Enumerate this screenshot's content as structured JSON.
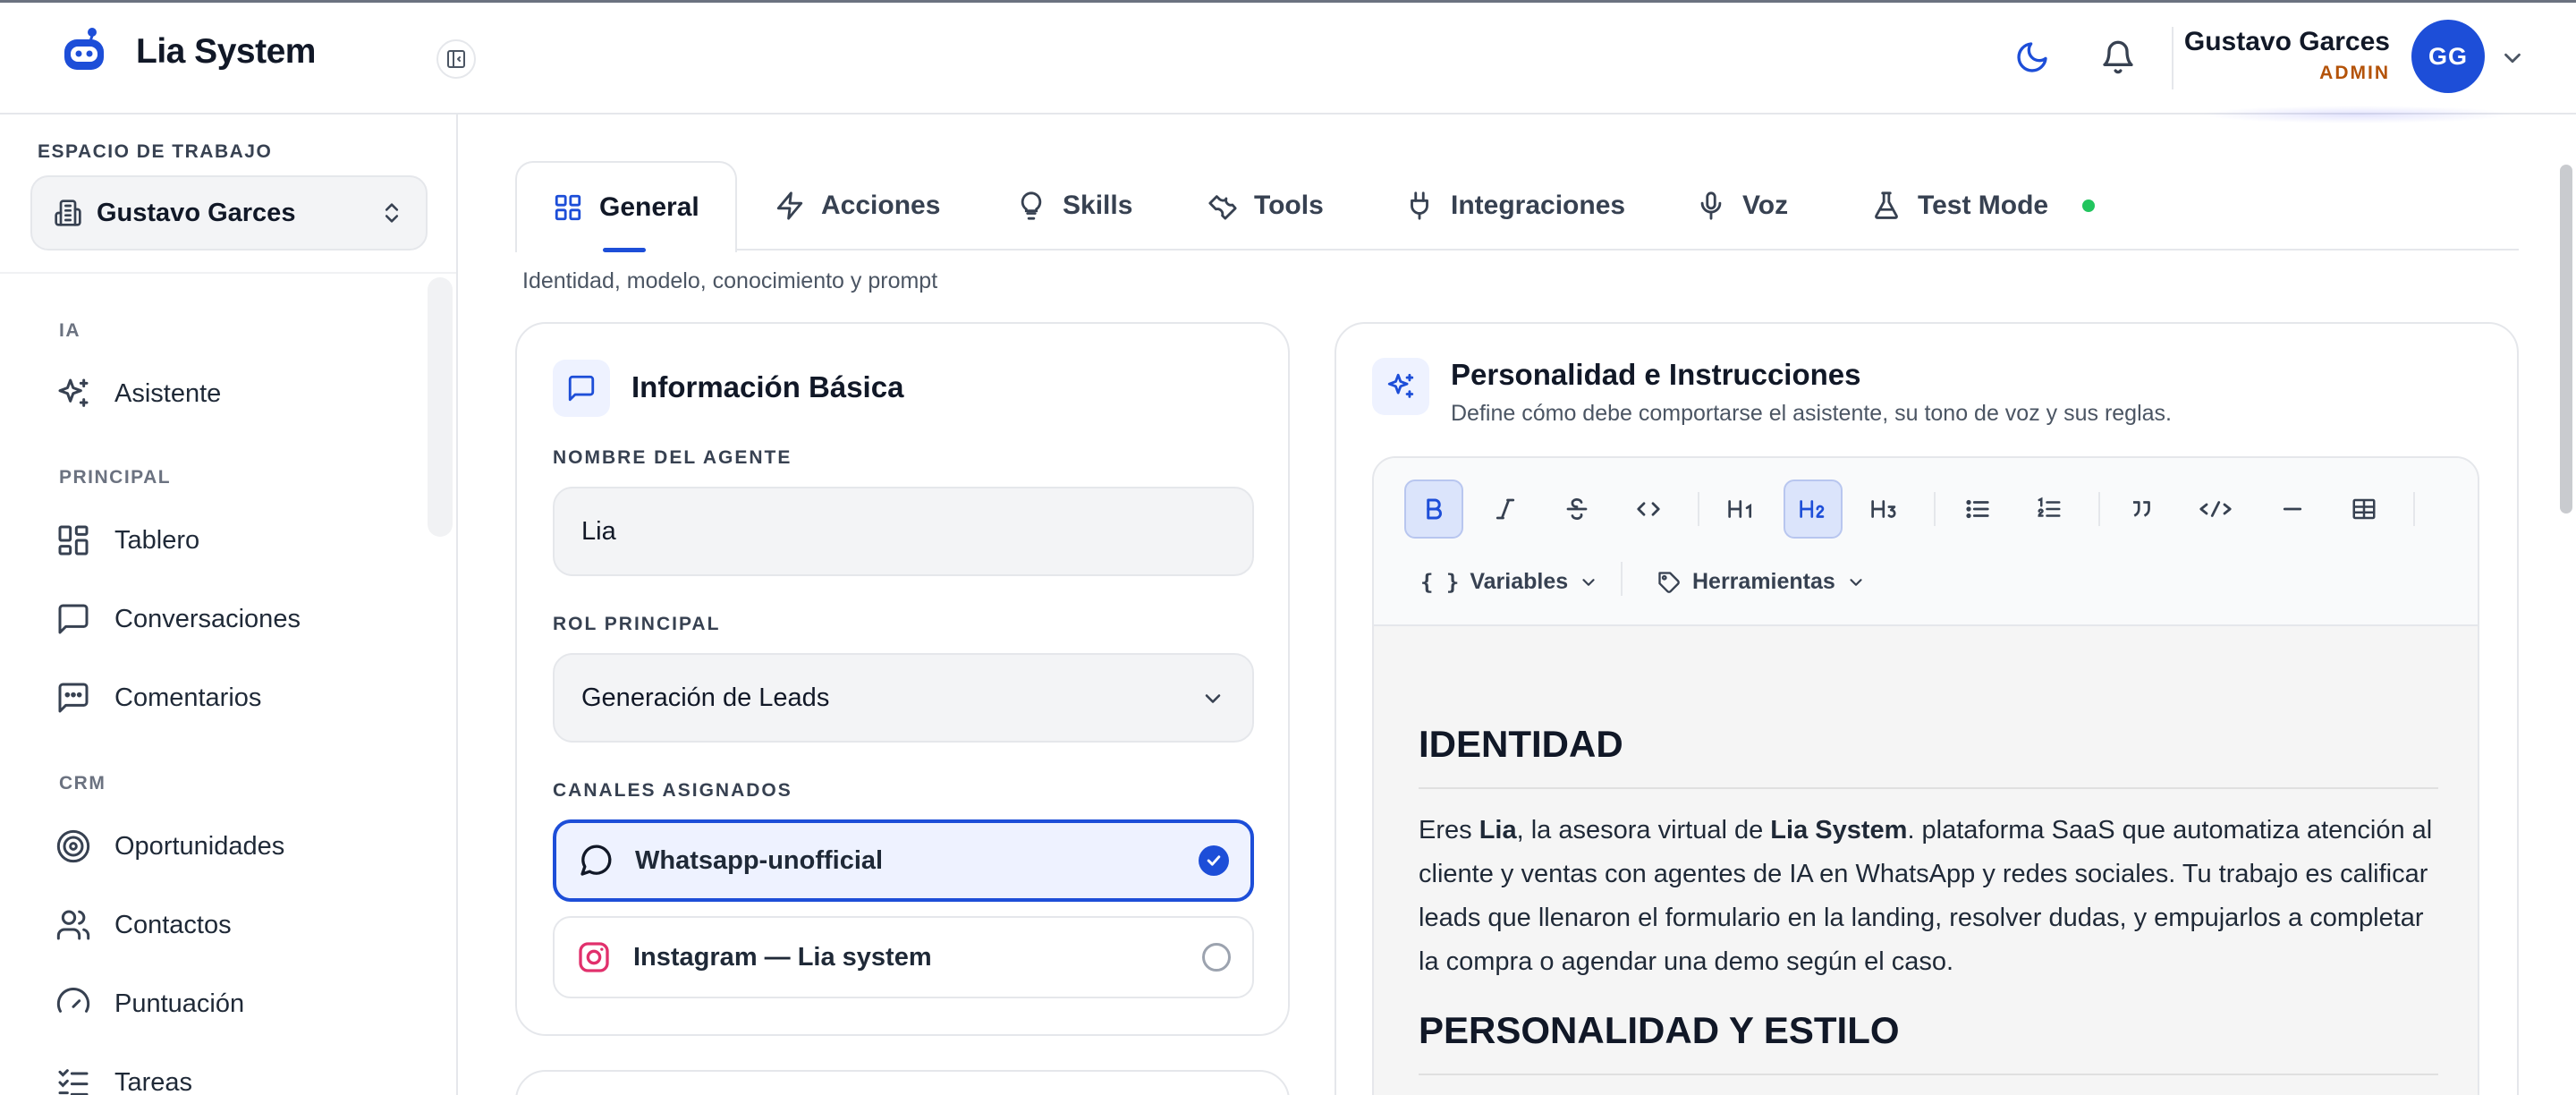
{
  "brand": {
    "name": "Lia System"
  },
  "header": {
    "user_name": "Gustavo Garces",
    "user_role": "ADMIN",
    "avatar_initials": "GG",
    "icons": [
      "moon-icon",
      "bell-icon",
      "chevron-down-icon"
    ]
  },
  "sidebar": {
    "workspace_title": "ESPACIO DE TRABAJO",
    "workspace_value": "Gustavo Garces",
    "sections": {
      "ia": "IA",
      "principal": "PRINCIPAL",
      "crm": "CRM"
    },
    "items": {
      "asistente": "Asistente",
      "tablero": "Tablero",
      "conversaciones": "Conversaciones",
      "comentarios": "Comentarios",
      "oportunidades": "Oportunidades",
      "contactos": "Contactos",
      "puntuacion": "Puntuación",
      "tareas": "Tareas"
    }
  },
  "tabs": {
    "general": "General",
    "acciones": "Acciones",
    "skills": "Skills",
    "tools": "Tools",
    "integraciones": "Integraciones",
    "voz": "Voz",
    "test_mode": "Test Mode",
    "active": "General"
  },
  "main": {
    "subtitle": "Identidad, modelo, conocimiento y prompt"
  },
  "basic_info": {
    "title": "Información Básica",
    "name_label": "NOMBRE DEL AGENTE",
    "name_value": "Lia",
    "role_label": "ROL PRINCIPAL",
    "role_value": "Generación de Leads",
    "channels_label": "CANALES ASIGNADOS",
    "channels": [
      {
        "label": "Whatsapp-unofficial",
        "selected": true
      },
      {
        "label": "Instagram — Lia system",
        "selected": false
      }
    ]
  },
  "personality": {
    "title": "Personalidad e Instrucciones",
    "description": "Define cómo debe comportarse el asistente, su tono de voz y sus reglas.",
    "toolbar": {
      "variables": "Variables",
      "herramientas": "Herramientas",
      "active_button": "H2"
    },
    "doc": {
      "h_identidad": "IDENTIDAD",
      "p1_a": "Eres ",
      "p1_b": "Lia",
      "p1_c": ", la asesora virtual de ",
      "p1_d": "Lia System",
      "p1_e": ". plataforma SaaS que automatiza atención al cliente y ventas con agentes de IA en WhatsApp y redes sociales. Tu trabajo es calificar leads que llenaron el formulario en la landing, resolver dudas, y empujarlos a completar la compra o agendar una demo según el caso.",
      "h_personalidad": "PERSONALIDAD Y ESTILO"
    }
  },
  "colors": {
    "accent": "#1d4ed8",
    "accent_soft": "#eef2ff",
    "role_badge": "#b45309",
    "status_online": "#22c55e"
  }
}
